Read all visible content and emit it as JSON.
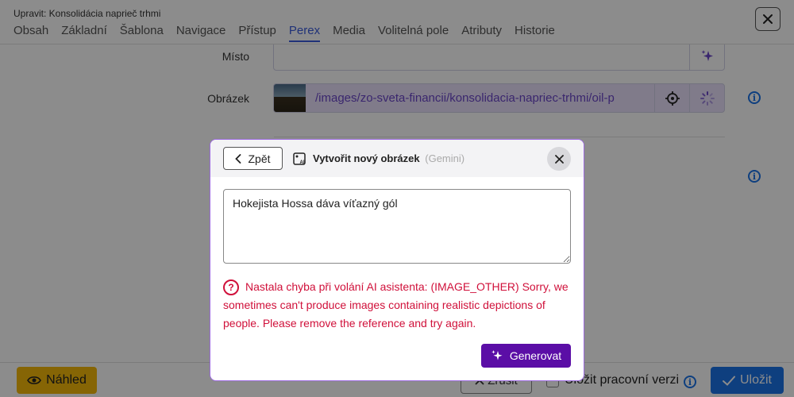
{
  "header": {
    "title": "Upravit: Konsolidácia naprieč trhmi",
    "tabs": [
      {
        "label": "Obsah"
      },
      {
        "label": "Základní"
      },
      {
        "label": "Šablona"
      },
      {
        "label": "Navigace"
      },
      {
        "label": "Přístup"
      },
      {
        "label": "Perex"
      },
      {
        "label": "Media"
      },
      {
        "label": "Volitelná pole"
      },
      {
        "label": "Atributy"
      },
      {
        "label": "Historie"
      }
    ],
    "active_tab": "Perex"
  },
  "form": {
    "misto_label": "Místo",
    "misto_value": "",
    "obrazek_label": "Obrázek",
    "obrazek_path": "/images/zo-sveta-financii/konsolidacia-napriec-trhmi/oil-p"
  },
  "footer": {
    "nahled_label": "Náhled",
    "zrusit_label": "Zrušit",
    "draft_label": "Uložit pracovní verzi",
    "draft_checked": false,
    "ulozit_label": "Uložit"
  },
  "modal": {
    "back_label": "Zpět",
    "title": "Vytvořit nový obrázek",
    "subtitle": "(Gemini)",
    "prompt": "Hokejista Hossa dáva víťazný gól",
    "error": "Nastala chyba při volání AI asistenta: (IMAGE_OTHER) Sorry, we sometimes can't produce images containing realistic depictions of people. Please remove the reference and try again.",
    "generate_label": "Generovat"
  },
  "colors": {
    "accent": "#3b5bdb",
    "primary": "#1a73e8",
    "warning": "#f5b90a",
    "error": "#d0103a",
    "generate": "#5b0ea6",
    "modal_border": "#9d6be0",
    "path_bg": "#e9e1fb"
  },
  "icons": {
    "close": "close-icon",
    "sparkles": "sparkles-icon",
    "spinner": "spinner-icon",
    "target": "crosshair-icon",
    "info": "info-icon",
    "eye": "eye-icon",
    "check": "check-icon",
    "chevron_left": "chevron-left-icon",
    "ai_image": "ai-image-icon",
    "error": "question-circle-icon"
  }
}
